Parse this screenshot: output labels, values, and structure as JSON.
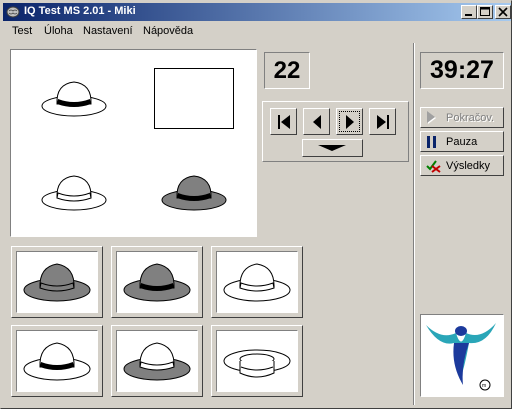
{
  "window": {
    "title": "IQ Test MS 2.01 - Miki"
  },
  "menu": [
    "Test",
    "Úloha",
    "Nastavení",
    "Nápověda"
  ],
  "question_number": "22",
  "timer": "39:27",
  "buttons": {
    "continue": "Pokračov.",
    "pause": "Pauza",
    "results": "Výsledky"
  },
  "icons": {
    "app": "brain-icon",
    "first": "skip-first-icon",
    "prev": "prev-icon",
    "play": "play-icon",
    "last": "skip-last-icon",
    "expand": "chevron-down-icon"
  },
  "colors": {
    "titlebar_start": "#0a246a",
    "titlebar_end": "#a6caf0",
    "face": "#d4d0c8",
    "hat_dark": "#808080",
    "pause_icon": "#0a246a",
    "results_check": "#008000",
    "results_x": "#c00000",
    "logo_cyan": "#2aa6b8",
    "logo_blue": "#1c3a9c"
  }
}
